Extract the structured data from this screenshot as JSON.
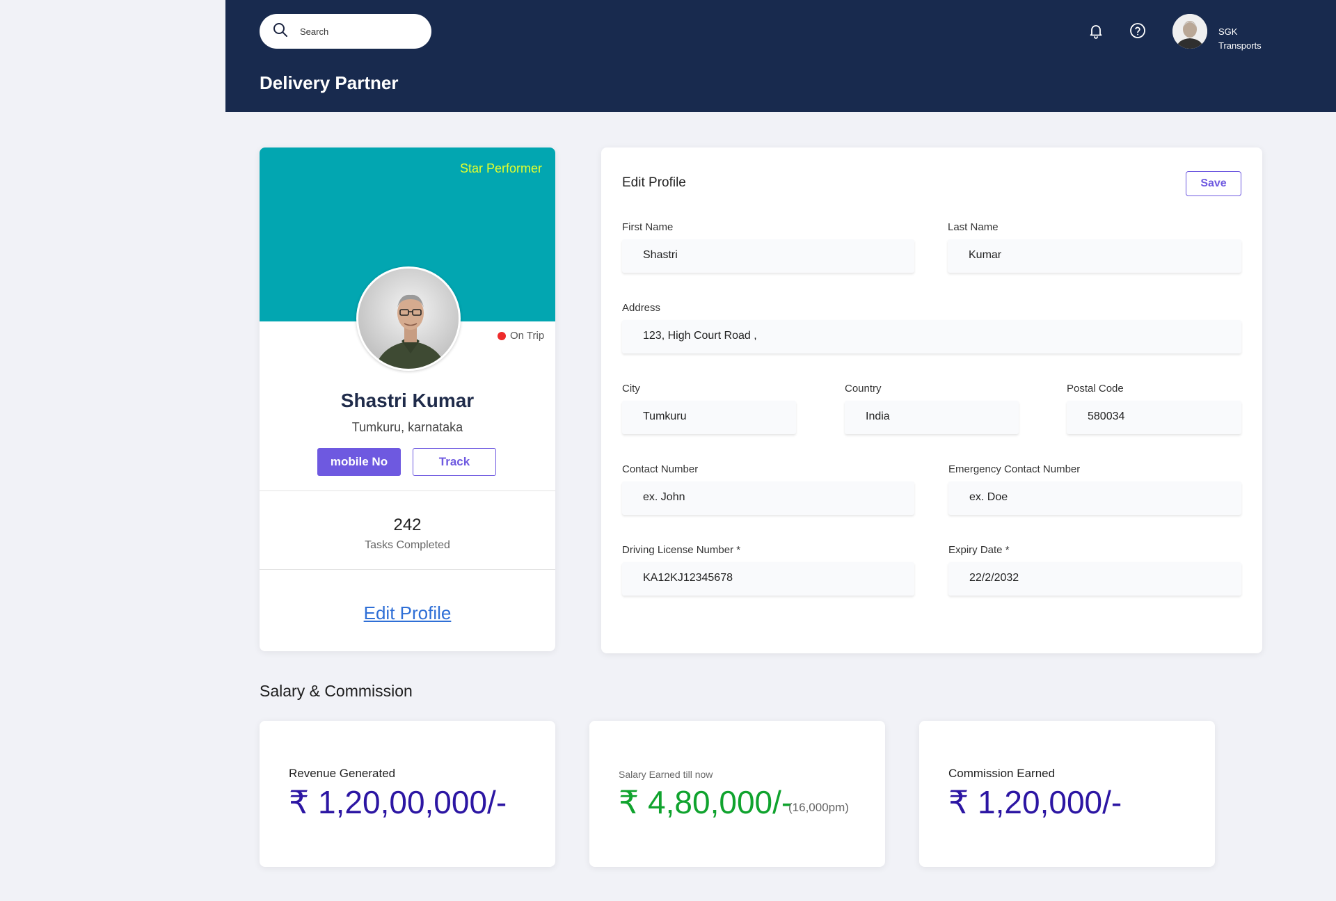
{
  "header": {
    "search_placeholder": "Search",
    "page_title": "Delivery Partner",
    "user": {
      "line1": "SGK",
      "line2": "Transports"
    }
  },
  "profile": {
    "badge": "Star Performer",
    "status": "On Trip",
    "name": "Shastri Kumar",
    "location": "Tumkuru, karnataka",
    "mobile_button": "mobile No",
    "track_button": "Track",
    "tasks_count": "242",
    "tasks_label": "Tasks Completed",
    "edit_link": "Edit Profile"
  },
  "edit_form": {
    "title": "Edit Profile",
    "save_button": "Save",
    "fields": {
      "first_name": {
        "label": "First Name",
        "value": "Shastri"
      },
      "last_name": {
        "label": "Last Name",
        "value": "Kumar"
      },
      "address": {
        "label": "Address",
        "value": "123, High Court Road ,"
      },
      "city": {
        "label": "City",
        "value": "Tumkuru"
      },
      "country": {
        "label": "Country",
        "value": "India"
      },
      "postal_code": {
        "label": "Postal Code",
        "value": "580034"
      },
      "contact_number": {
        "label": "Contact Number",
        "placeholder": "ex. John"
      },
      "emergency_contact": {
        "label": "Emergency Contact Number",
        "placeholder": "ex. Doe"
      },
      "license": {
        "label": "Driving License Number *",
        "value": "KA12KJ12345678"
      },
      "expiry": {
        "label": "Expiry Date *",
        "value": "22/2/2032"
      }
    }
  },
  "salary": {
    "title": "Salary & Commission",
    "revenue": {
      "label": "Revenue Generated",
      "value": "₹ 1,20,00,000/-"
    },
    "salary": {
      "label": "Salary Earned till now",
      "value": "₹ 4,80,000/-",
      "sub": "(16,000pm)"
    },
    "commission": {
      "label": "Commission Earned",
      "value": "₹ 1,20,000/-"
    }
  },
  "colors": {
    "header_bg": "#182a4e",
    "banner": "#02a6b1",
    "accent": "#6e59e0",
    "badge": "#e4ff2c",
    "status_dot": "#ee2b2b",
    "money_blue": "#2c16a3",
    "money_green": "#10a32e",
    "link": "#2f6fd6"
  },
  "icons": [
    "search-icon",
    "bell-icon",
    "help-icon"
  ]
}
